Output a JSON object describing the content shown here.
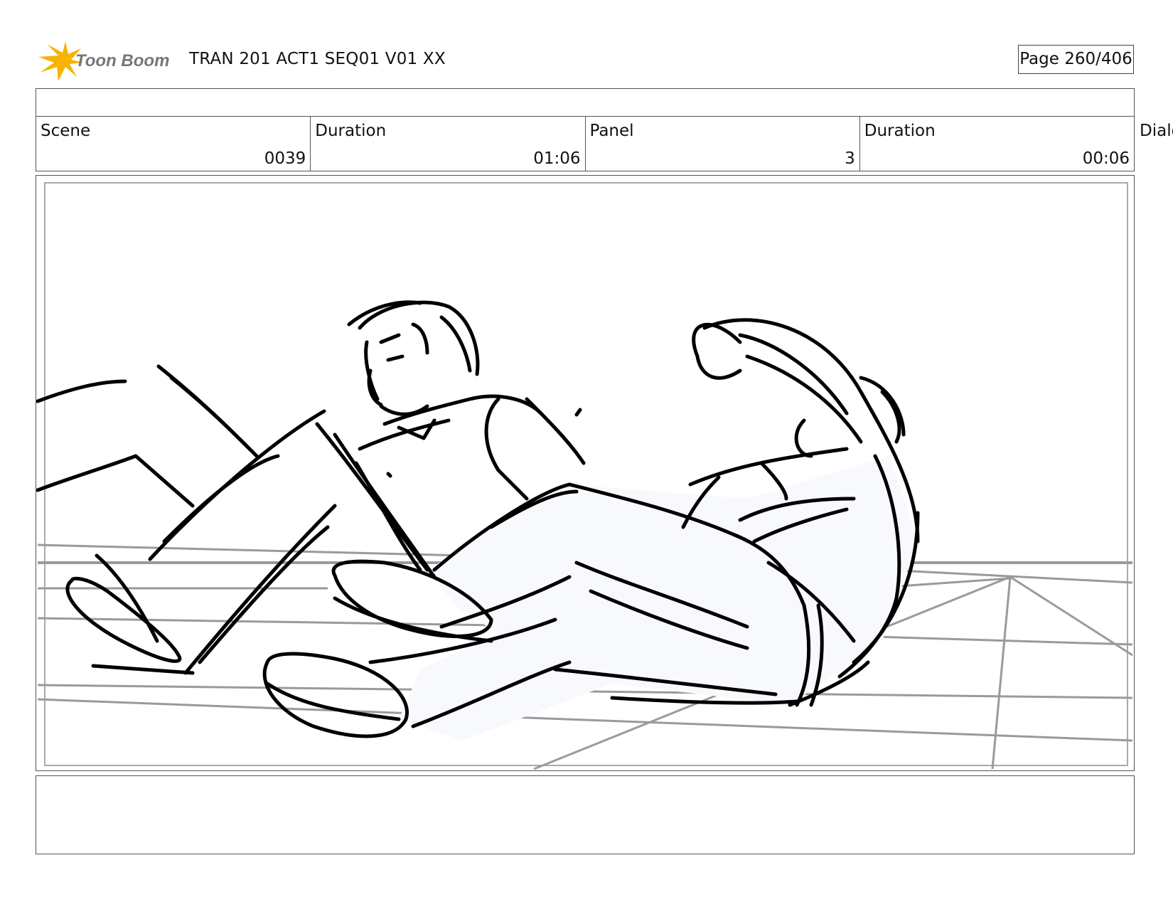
{
  "header": {
    "logo_text": "Toon Boom",
    "project_title": "TRAN 201 ACT1 SEQ01 V01 XX",
    "page_indicator": "Page 260/406"
  },
  "info": {
    "scene_label": "Scene",
    "scene_value": "0039",
    "scene_duration_label": "Duration",
    "scene_duration_value": "01:06",
    "panel_label": "Panel",
    "panel_value": "3",
    "panel_duration_label": "Duration",
    "panel_duration_value": "00:06",
    "dialogue_label_cut": "Dialo"
  },
  "panel": {
    "description": "",
    "colors": {
      "ink": "#000000",
      "floor_grid": "#9a9a9a",
      "fill": "#f7f9fd"
    }
  },
  "dialogue": {
    "text": ""
  }
}
